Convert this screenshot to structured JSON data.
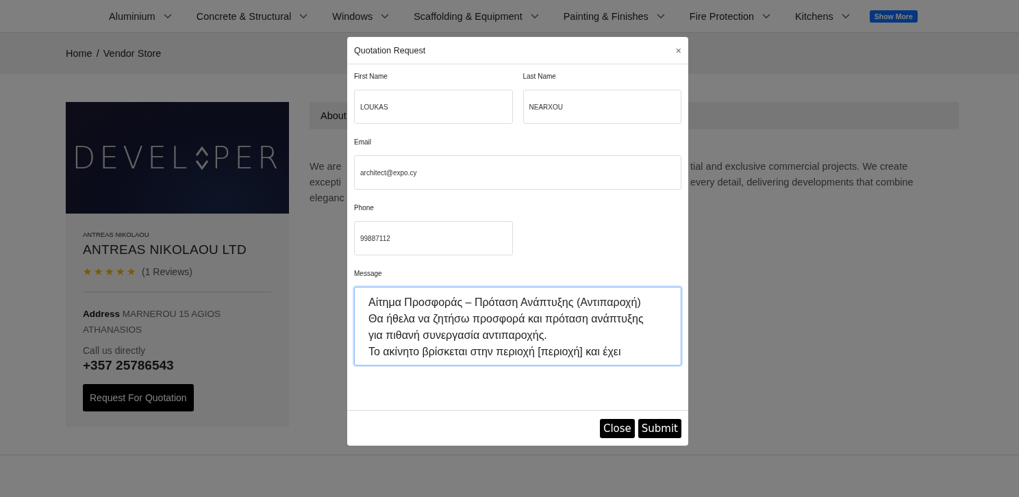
{
  "nav": {
    "items": [
      {
        "label": "Aluminium"
      },
      {
        "label": "Concrete & Structural"
      },
      {
        "label": "Windows"
      },
      {
        "label": "Scaffolding & Equipment"
      },
      {
        "label": "Painting & Finishes"
      },
      {
        "label": "Fire Protection"
      },
      {
        "label": "Kitchens"
      }
    ],
    "more_button": "Show More"
  },
  "breadcrumb": {
    "items": [
      "Home",
      "Vendor Store"
    ],
    "separator": "/"
  },
  "vendor": {
    "logo": {
      "left": "DEVEL",
      "right": "PER"
    },
    "owner": "ANTREAS NIKOLAOU",
    "name": "ANTREAS NIKOLAOU LTD",
    "stars": 5,
    "reviews": "(1 Reviews)",
    "address_label": "Address",
    "address": "MARNEROU 15 AGIOS ATHANASIOS",
    "call_label": "Call us directly",
    "phone": "+357 25786543",
    "quote_button": "Request For Quotation"
  },
  "about": {
    "tab": "About",
    "lines": [
      {
        "left": "We are",
        "right": "tial and exclusive commercial projects. We create"
      },
      {
        "left": "excepti",
        "right": "every detail, delivering developments that combine"
      },
      {
        "left": "eleganc"
      }
    ]
  },
  "modal": {
    "title": "Quotation Request",
    "close_icon": "×",
    "fields": [
      {
        "label": "First Name",
        "value": "LOUKAS",
        "kind": "text"
      },
      {
        "label": "Last Name",
        "value": "NEARXOU",
        "kind": "text"
      },
      {
        "label": "Email",
        "value": "architect@expo.cy",
        "kind": "email"
      },
      {
        "label": "Phone",
        "value": "99887112",
        "kind": "phone"
      }
    ],
    "message": {
      "label": "Message",
      "value": "Αίτημα Προσφοράς – Πρόταση Ανάπτυξης (Αντιπαροχή)\nΘα ήθελα να ζητήσω προσφορά και πρόταση ανάπτυξης για πιθανή συνεργασία αντιπαροχής.\nΤο ακίνητο βρίσκεται στην περιοχή [περιοχή] και έχει",
      "focused": true
    },
    "buttons": [
      "Close",
      "Submit"
    ]
  }
}
